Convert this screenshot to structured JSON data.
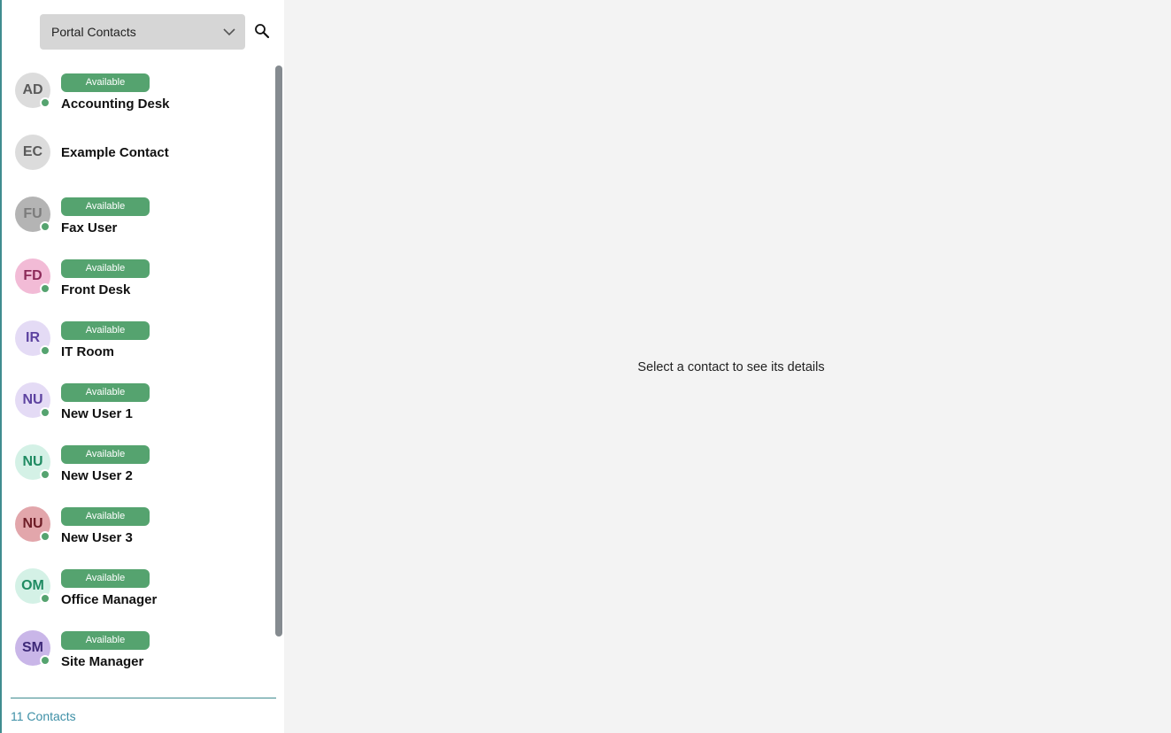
{
  "sidebar": {
    "source_select": {
      "value": "Portal Contacts",
      "icon": "chevron-down-icon"
    },
    "search_icon": "search-icon",
    "status_color": "#55a36f",
    "contacts": [
      {
        "initials": "AD",
        "name": "Accounting Desk",
        "status": "Available",
        "avatar_bg": "#dcdcdc",
        "avatar_fg": "#5a5a5a"
      },
      {
        "initials": "EC",
        "name": "Example Contact",
        "status": "",
        "avatar_bg": "#dcdcdc",
        "avatar_fg": "#5a5a5a"
      },
      {
        "initials": "FU",
        "name": "Fax User",
        "status": "Available",
        "avatar_bg": "#b4b4b4",
        "avatar_fg": "#7c7c7c"
      },
      {
        "initials": "FD",
        "name": "Front Desk",
        "status": "Available",
        "avatar_bg": "#f2bbd6",
        "avatar_fg": "#8c2a59"
      },
      {
        "initials": "IR",
        "name": "IT Room",
        "status": "Available",
        "avatar_bg": "#e4dbf5",
        "avatar_fg": "#5d43a0"
      },
      {
        "initials": "NU",
        "name": "New User 1",
        "status": "Available",
        "avatar_bg": "#e4dbf5",
        "avatar_fg": "#5d43a0"
      },
      {
        "initials": "NU",
        "name": "New User 2",
        "status": "Available",
        "avatar_bg": "#d4f1e6",
        "avatar_fg": "#1f8b62"
      },
      {
        "initials": "NU",
        "name": "New User 3",
        "status": "Available",
        "avatar_bg": "#e2a6ab",
        "avatar_fg": "#6e1d27"
      },
      {
        "initials": "OM",
        "name": "Office Manager",
        "status": "Available",
        "avatar_bg": "#d4f1e6",
        "avatar_fg": "#1f8b62"
      },
      {
        "initials": "SM",
        "name": "Site Manager",
        "status": "Available",
        "avatar_bg": "#c9b6e8",
        "avatar_fg": "#3e2a78"
      }
    ],
    "footer": {
      "count_label": "11 Contacts"
    }
  },
  "main": {
    "empty_message": "Select a contact to see its details"
  }
}
